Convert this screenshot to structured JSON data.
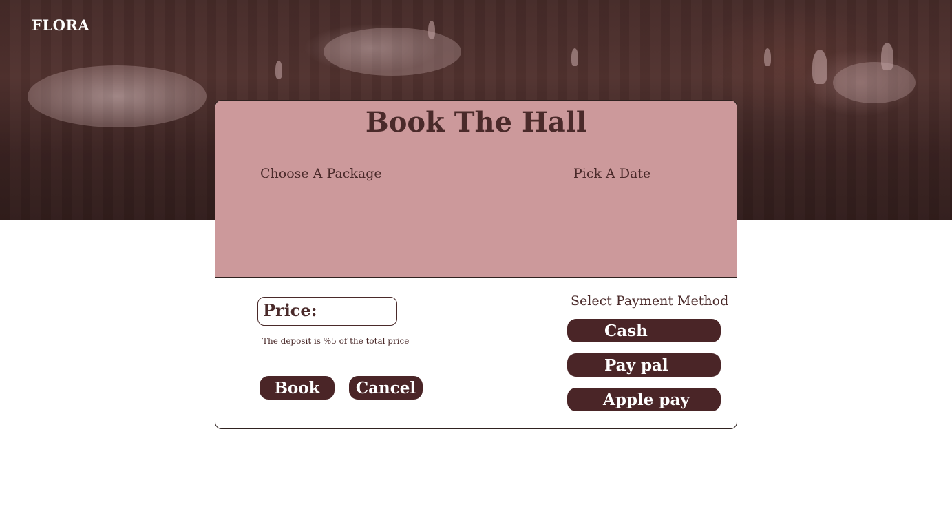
{
  "brand": {
    "name": "FLORA"
  },
  "booking": {
    "title": "Book The Hall",
    "package_label": "Choose A Package",
    "date_label": "Pick A Date",
    "price_label": "Price:",
    "deposit_note": "The deposit is %5 of the total price",
    "book_label": "Book",
    "cancel_label": "Cancel"
  },
  "payment": {
    "label": "Select Payment Method",
    "options": [
      {
        "label": "Cash"
      },
      {
        "label": "Pay pal"
      },
      {
        "label": "Apple pay"
      }
    ]
  },
  "colors": {
    "accent": "#4a2527",
    "panel": "#cc999b",
    "text": "#4a2a2a"
  }
}
